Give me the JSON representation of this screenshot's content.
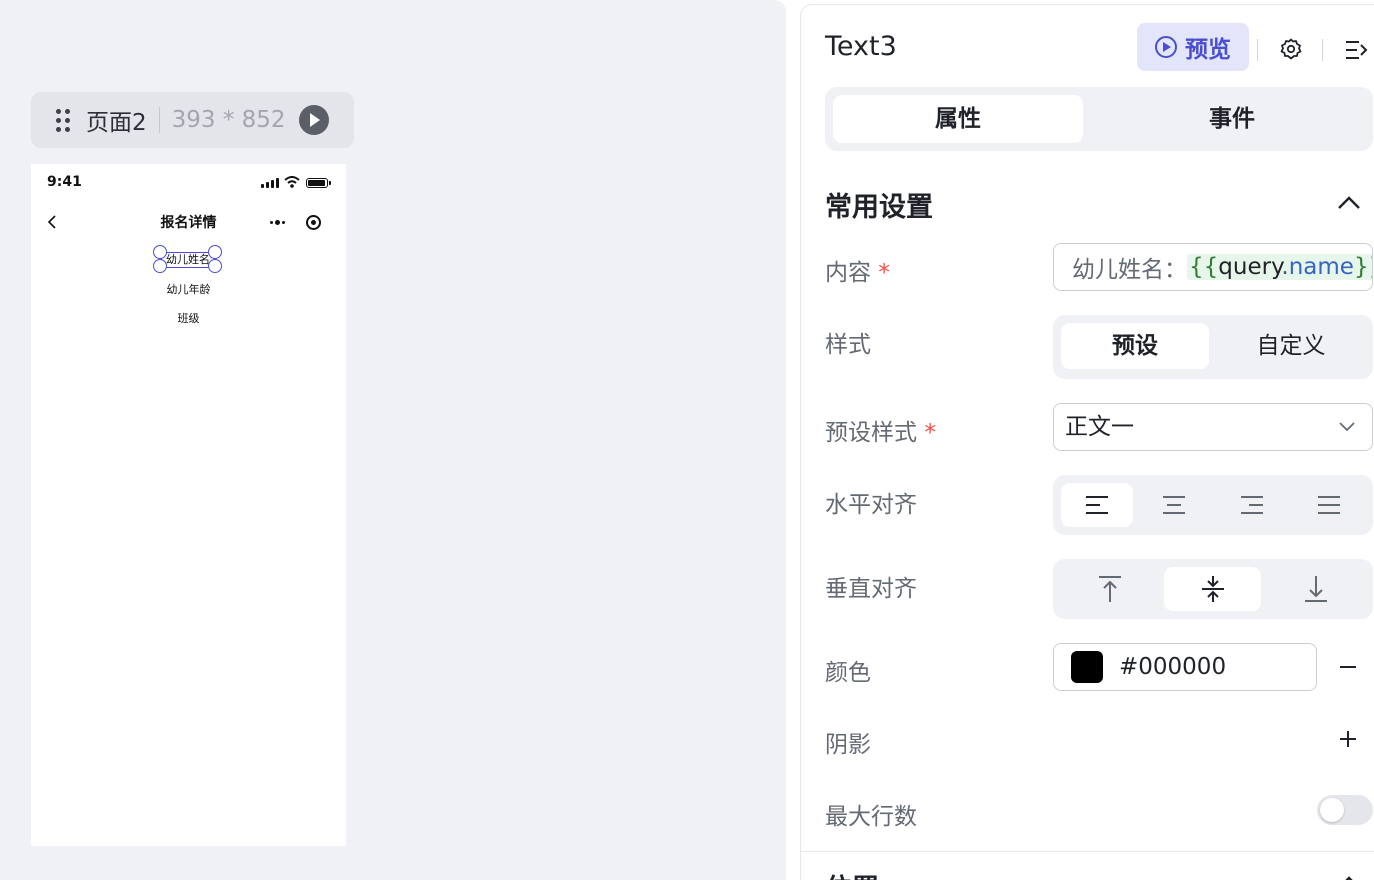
{
  "canvas": {
    "page_tag": {
      "name": "页面2",
      "size": "393 * 852"
    },
    "phone": {
      "status_time": "9:41",
      "nav_title": "报名详情",
      "texts": [
        "幼儿姓名",
        "幼儿年龄",
        "班级"
      ]
    }
  },
  "panel": {
    "component_name": "Text3",
    "preview_label": "预览",
    "tabs": [
      "属性",
      "事件"
    ],
    "section_common": "常用设置",
    "content": {
      "label": "内容",
      "required_mark": "*",
      "prefix": "幼儿姓名：",
      "expr_open": "{{",
      "expr_key": "query",
      "expr_dot": ".",
      "expr_prop": "name",
      "expr_close": "}}"
    },
    "style": {
      "label": "样式",
      "options": [
        "预设",
        "自定义"
      ],
      "selected": "预设"
    },
    "preset_style": {
      "label": "预设样式",
      "required_mark": "*",
      "value": "正文一"
    },
    "h_align": {
      "label": "水平对齐",
      "options": [
        "align-left-icon",
        "align-center-icon",
        "align-right-icon",
        "align-justify-icon"
      ],
      "selected": "align-left-icon"
    },
    "v_align": {
      "label": "垂直对齐",
      "options": [
        "align-top-icon",
        "align-middle-icon",
        "align-bottom-icon"
      ],
      "selected": "align-middle-icon"
    },
    "color": {
      "label": "颜色",
      "value": "#000000"
    },
    "shadow": {
      "label": "阴影"
    },
    "max_lines": {
      "label": "最大行数",
      "enabled": false
    },
    "section_next": "位置"
  },
  "theme": {
    "accent": "#4b4fcf",
    "accent_bg": "#e3e5fb",
    "required": "#f54a45",
    "selection": "#4a4ed6"
  }
}
